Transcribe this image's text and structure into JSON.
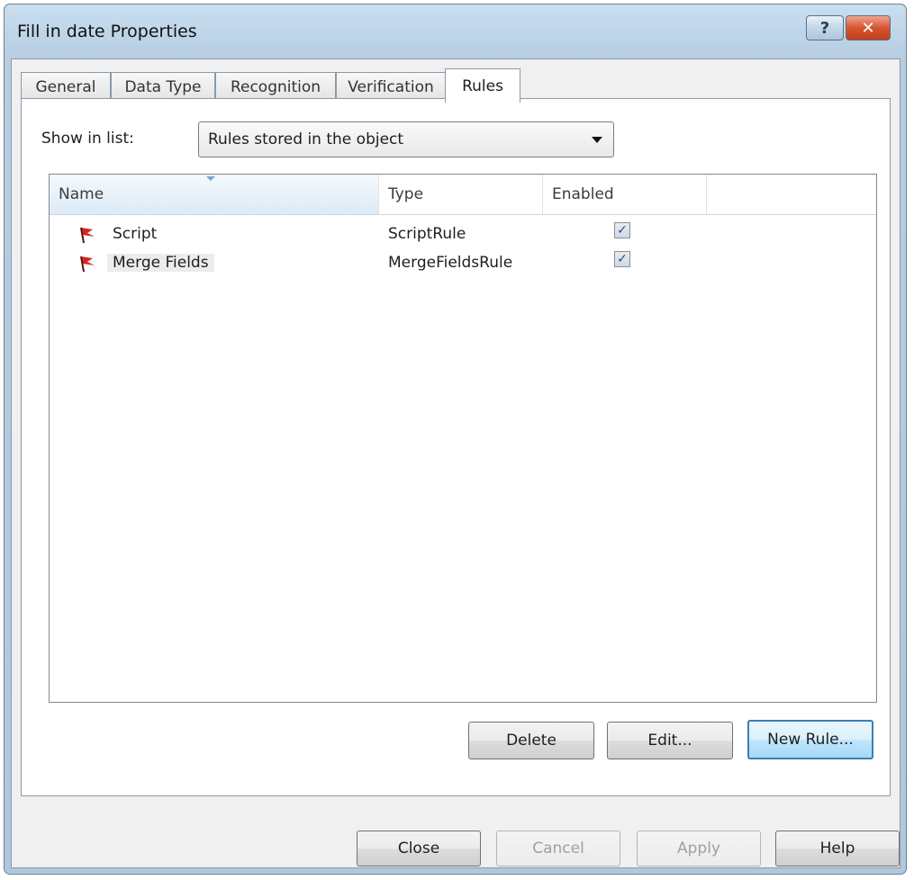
{
  "window": {
    "title": "Fill in date Properties",
    "help_glyph": "?",
    "close_glyph": "✕"
  },
  "tabs": [
    {
      "label": "General"
    },
    {
      "label": "Data Type"
    },
    {
      "label": "Recognition"
    },
    {
      "label": "Verification"
    },
    {
      "label": "Rules",
      "active": true
    }
  ],
  "filter": {
    "label": "Show in list:",
    "value": "Rules stored in the object"
  },
  "list": {
    "columns": [
      "Name",
      "Type",
      "Enabled"
    ],
    "rows": [
      {
        "name": "Script",
        "type": "ScriptRule",
        "enabled": true,
        "icon": "flag-icon"
      },
      {
        "name": "Merge Fields",
        "type": "MergeFieldsRule",
        "enabled": true,
        "icon": "flag-icon"
      }
    ],
    "check_glyph": "✓"
  },
  "rule_buttons": {
    "delete": "Delete",
    "edit": "Edit...",
    "new_rule": "New Rule..."
  },
  "dialog_buttons": {
    "close": "Close",
    "cancel": "Cancel",
    "apply": "Apply",
    "help": "Help"
  },
  "colors": {
    "flag": "#d8261c",
    "accent": "#3c7fb1"
  }
}
